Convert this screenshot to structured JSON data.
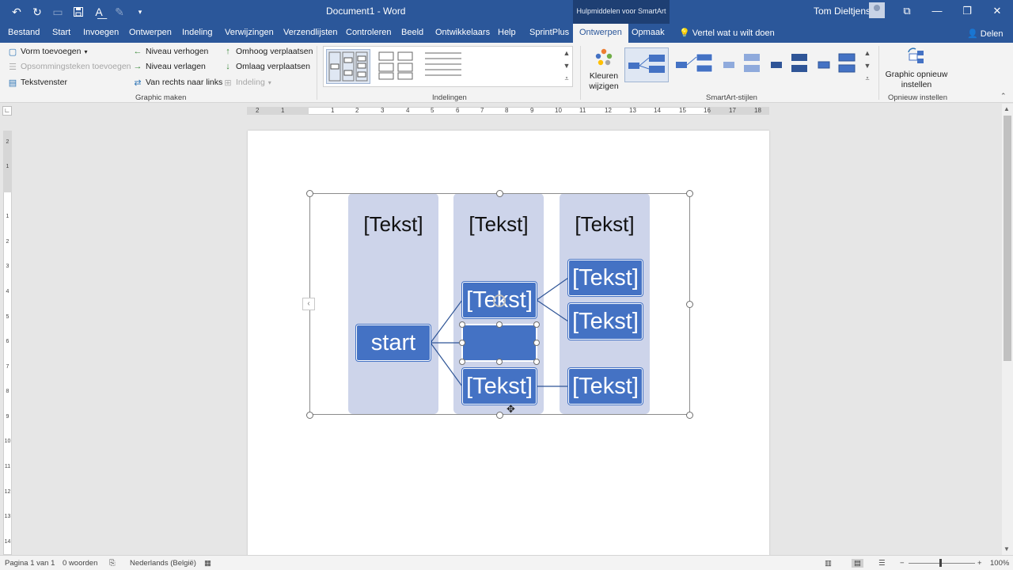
{
  "window": {
    "doc_title": "Document1 - Word",
    "context_header": "Hulpmiddelen voor SmartArt",
    "user_name": "Tom Dieltjens"
  },
  "tabs": [
    {
      "label": "Bestand"
    },
    {
      "label": "Start"
    },
    {
      "label": "Invoegen"
    },
    {
      "label": "Ontwerpen"
    },
    {
      "label": "Indeling"
    },
    {
      "label": "Verwijzingen"
    },
    {
      "label": "Verzendlijsten"
    },
    {
      "label": "Controleren"
    },
    {
      "label": "Beeld"
    },
    {
      "label": "Ontwikkelaars"
    },
    {
      "label": "Help"
    },
    {
      "label": "SprintPlus"
    },
    {
      "label": "Ontwerpen"
    },
    {
      "label": "Opmaak"
    }
  ],
  "tell_me": "Vertel wat u wilt doen",
  "share": "Delen",
  "ribbon": {
    "graphic_maken": {
      "label": "Graphic maken",
      "vorm_toevoegen": "Vorm toevoegen",
      "opsommingsteken": "Opsommingsteken toevoegen",
      "tekstvenster": "Tekstvenster",
      "niveau_verhogen": "Niveau verhogen",
      "niveau_verlagen": "Niveau verlagen",
      "rechts_naar_links": "Van rechts naar links",
      "omhoog": "Omhoog verplaatsen",
      "omlaag": "Omlaag verplaatsen",
      "indeling": "Indeling"
    },
    "indelingen_label": "Indelingen",
    "kleuren": "Kleuren wijzigen",
    "smartart_stijlen_label": "SmartArt-stijlen",
    "reset": "Graphic opnieuw instellen",
    "opnieuw_label": "Opnieuw instellen"
  },
  "ruler_h": [
    "2",
    "1",
    "1",
    "2",
    "3",
    "4",
    "5",
    "6",
    "7",
    "8",
    "9",
    "10",
    "11",
    "12",
    "13",
    "14",
    "15",
    "16",
    "17",
    "18"
  ],
  "ruler_v": [
    "2",
    "1",
    "1",
    "2",
    "3",
    "4",
    "5",
    "6",
    "7",
    "8",
    "9",
    "10",
    "11",
    "12",
    "13",
    "14"
  ],
  "smartart": {
    "columns": [
      "[Tekst]",
      "[Tekst]",
      "[Tekst]"
    ],
    "start_node": "start",
    "mid_top": "[Tekst]",
    "mid_selected": "",
    "mid_bottom": "[Tekst]",
    "right_1": "[Tekst]",
    "right_2": "[Tekst]",
    "right_3": "[Tekst]"
  },
  "status": {
    "page": "Pagina 1 van 1",
    "words": "0 woorden",
    "language": "Nederlands (België)",
    "zoom": "100%"
  },
  "colors": {
    "word_blue": "#2b579a",
    "node_fill": "#4472c4",
    "column_fill": "#cdd4ea"
  }
}
